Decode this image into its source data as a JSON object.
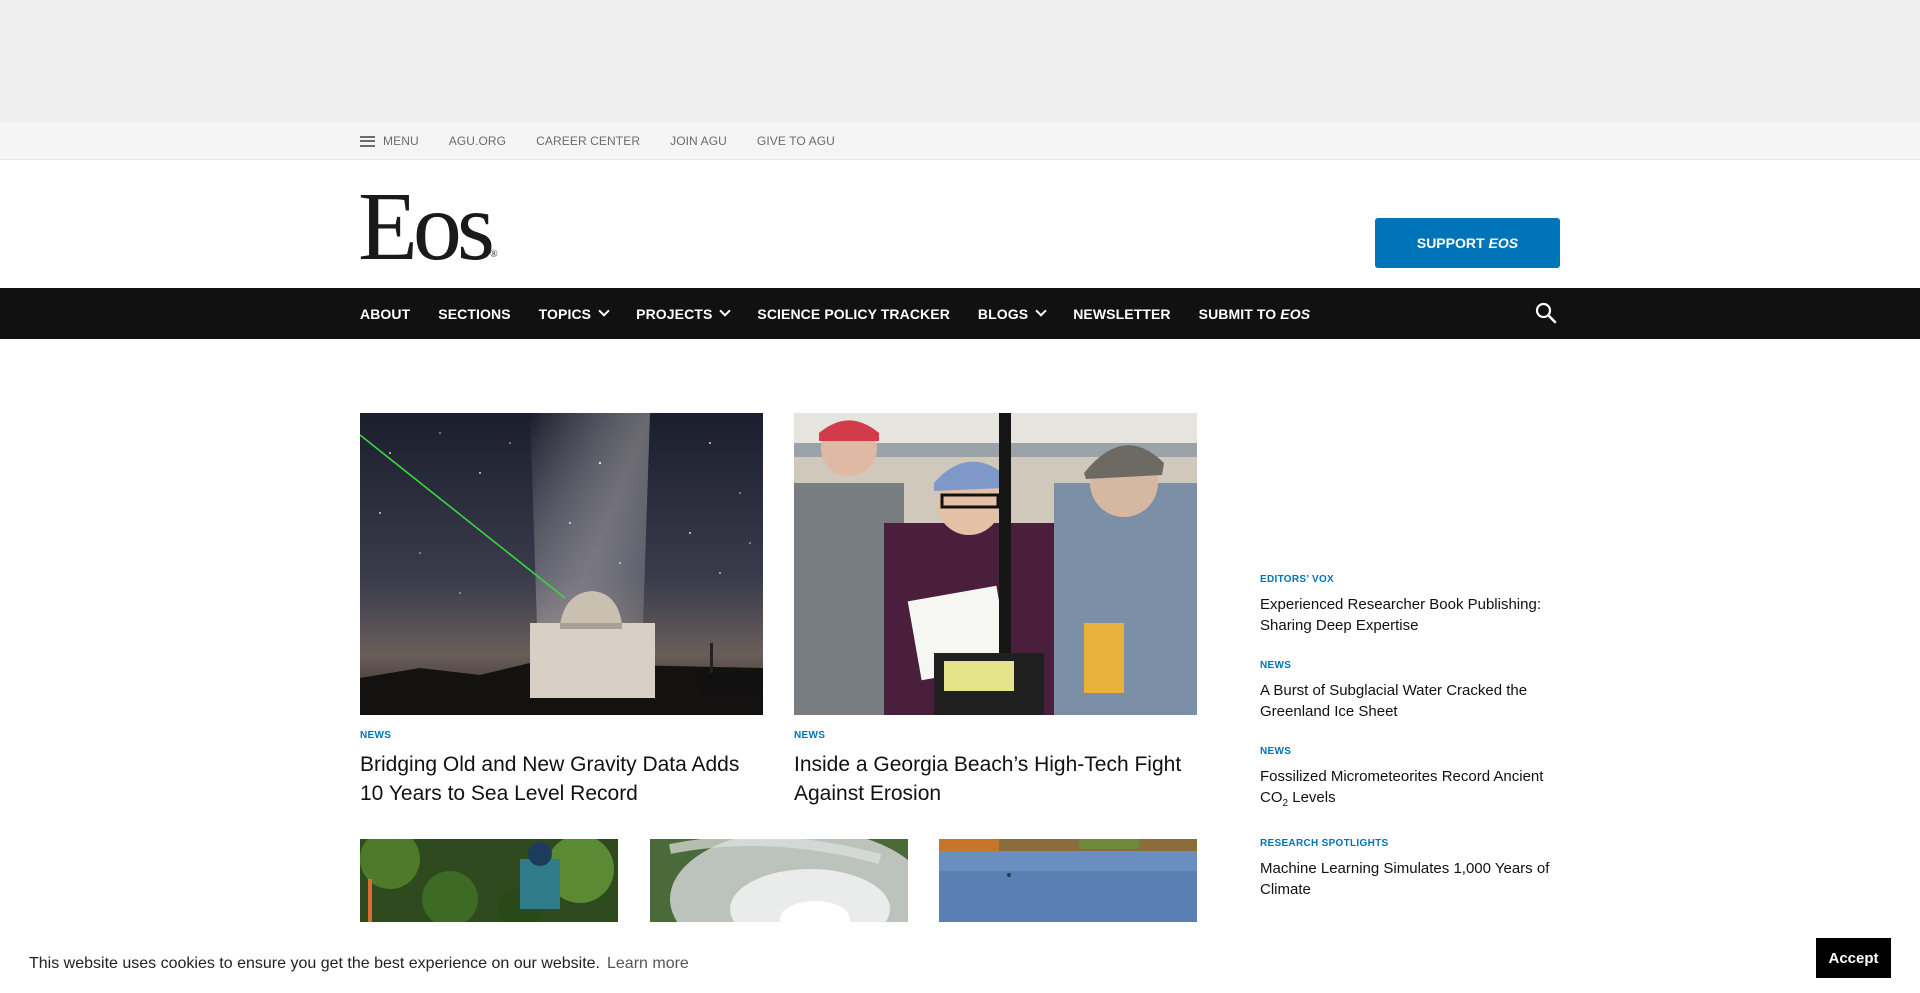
{
  "utility_bar": {
    "menu_label": "MENU",
    "links": [
      "AGU.ORG",
      "CAREER CENTER",
      "JOIN AGU",
      "GIVE TO AGU"
    ]
  },
  "masthead": {
    "logo_text": "Eos",
    "logo_mark": "®",
    "support_label": "SUPPORT",
    "support_label_em": "EOS"
  },
  "main_nav": {
    "items": [
      {
        "label": "ABOUT",
        "dropdown": false
      },
      {
        "label": "SECTIONS",
        "dropdown": false
      },
      {
        "label": "TOPICS",
        "dropdown": true
      },
      {
        "label": "PROJECTS",
        "dropdown": true
      },
      {
        "label": "SCIENCE POLICY TRACKER",
        "dropdown": false
      },
      {
        "label": "BLOGS",
        "dropdown": true
      },
      {
        "label": "NEWSLETTER",
        "dropdown": false
      }
    ],
    "submit_label": "SUBMIT TO",
    "submit_label_em": "EOS",
    "search_icon": "search-icon"
  },
  "features": [
    {
      "kicker": "NEWS",
      "headline": "Bridging Old and New Gravity Data Adds 10 Years to Sea Level Record"
    },
    {
      "kicker": "NEWS",
      "headline": "Inside a Georgia Beach’s High-Tech Fight Against Erosion"
    }
  ],
  "sidebar": {
    "items": [
      {
        "kicker": "EDITORS’ VOX",
        "headline": "Experienced Researcher Book Publishing: Sharing Deep Expertise"
      },
      {
        "kicker": "NEWS",
        "headline": "A Burst of Subglacial Water Cracked the Greenland Ice Sheet"
      },
      {
        "kicker": "NEWS",
        "headline_pre": "Fossilized Micrometeorites Record Ancient CO",
        "headline_sub": "2",
        "headline_post": " Levels"
      },
      {
        "kicker": "RESEARCH SPOTLIGHTS",
        "headline": "Machine Learning Simulates 1,000 Years of Climate"
      }
    ]
  },
  "cookie_banner": {
    "message": "This website uses cookies to ensure you get the best experience on our website.",
    "learn_more": "Learn more",
    "accept": "Accept"
  },
  "colors": {
    "accent": "#0074b8",
    "nav_bg": "#111111",
    "utility_bg": "#f5f5f5",
    "ad_bg": "#efefef"
  }
}
